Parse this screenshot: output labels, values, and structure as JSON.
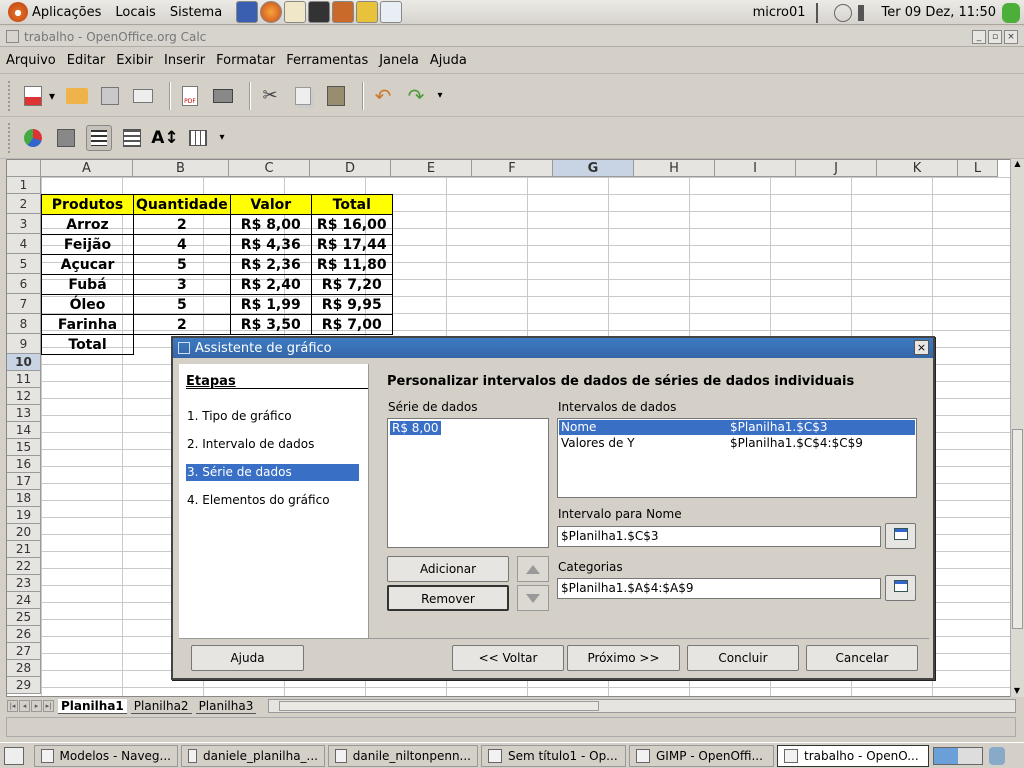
{
  "topbar": {
    "menus": [
      "Aplicações",
      "Locais",
      "Sistema"
    ],
    "user": "micro01",
    "clock": "Ter 09 Dez, 11:50"
  },
  "window": {
    "title": "trabalho - OpenOffice.org Calc"
  },
  "menubar": [
    "Arquivo",
    "Editar",
    "Exibir",
    "Inserir",
    "Formatar",
    "Ferramentas",
    "Janela",
    "Ajuda"
  ],
  "sheet": {
    "columns": [
      "A",
      "B",
      "C",
      "D",
      "E",
      "F",
      "G",
      "H",
      "I",
      "J",
      "K",
      "L"
    ],
    "active_column": "G",
    "rows": [
      "1",
      "2",
      "3",
      "4",
      "5",
      "6",
      "7",
      "8",
      "9",
      "10",
      "11",
      "12",
      "13",
      "14",
      "15",
      "16",
      "17",
      "18",
      "19",
      "20",
      "21",
      "22",
      "23",
      "24",
      "25",
      "26",
      "27",
      "28",
      "29"
    ],
    "active_row": "10",
    "table": {
      "headers": [
        "Produtos",
        "Quantidade",
        "Valor",
        "Total"
      ],
      "data": [
        [
          "Arroz",
          "2",
          "R$ 8,00",
          "R$ 16,00"
        ],
        [
          "Feijão",
          "4",
          "R$ 4,36",
          "R$ 17,44"
        ],
        [
          "Açucar",
          "5",
          "R$ 2,36",
          "R$ 11,80"
        ],
        [
          "Fubá",
          "3",
          "R$ 2,40",
          "R$ 7,20"
        ],
        [
          "Óleo",
          "5",
          "R$ 1,99",
          "R$ 9,95"
        ],
        [
          "Farinha",
          "2",
          "R$ 3,50",
          "R$ 7,00"
        ]
      ],
      "total_label": "Total"
    },
    "tabs": [
      "Planilha1",
      "Planilha2",
      "Planilha3"
    ],
    "active_tab": "Planilha1"
  },
  "dialog": {
    "title": "Assistente de gráfico",
    "steps_header": "Etapas",
    "steps": [
      "1. Tipo de gráfico",
      "2. Intervalo de dados",
      "3. Série de dados",
      "4. Elementos do gráfico"
    ],
    "active_step": 2,
    "heading": "Personalizar intervalos de dados de séries de dados individuais",
    "series_label": "Série de dados",
    "series_items": [
      "R$ 8,00"
    ],
    "ranges_label": "Intervalos de dados",
    "ranges": [
      {
        "name": "Nome",
        "value": "$Planilha1.$C$3"
      },
      {
        "name": "Valores de Y",
        "value": "$Planilha1.$C$4:$C$9"
      }
    ],
    "range_name_label": "Intervalo para Nome",
    "range_name_value": "$Planilha1.$C$3",
    "categories_label": "Categorias",
    "categories_value": "$Planilha1.$A$4:$A$9",
    "add_button": "Adicionar",
    "remove_button": "Remover",
    "help_button": "Ajuda",
    "back_button": "<< Voltar",
    "next_button": "Próximo >>",
    "finish_button": "Concluir",
    "cancel_button": "Cancelar"
  },
  "taskbar": [
    {
      "label": "Modelos - Naveg...",
      "active": false
    },
    {
      "label": "daniele_planilha_...",
      "active": false
    },
    {
      "label": "danile_niltonpenn...",
      "active": false
    },
    {
      "label": "Sem título1 - Op...",
      "active": false
    },
    {
      "label": "GIMP - OpenOffi...",
      "active": false
    },
    {
      "label": "trabalho - OpenO...",
      "active": true
    }
  ]
}
